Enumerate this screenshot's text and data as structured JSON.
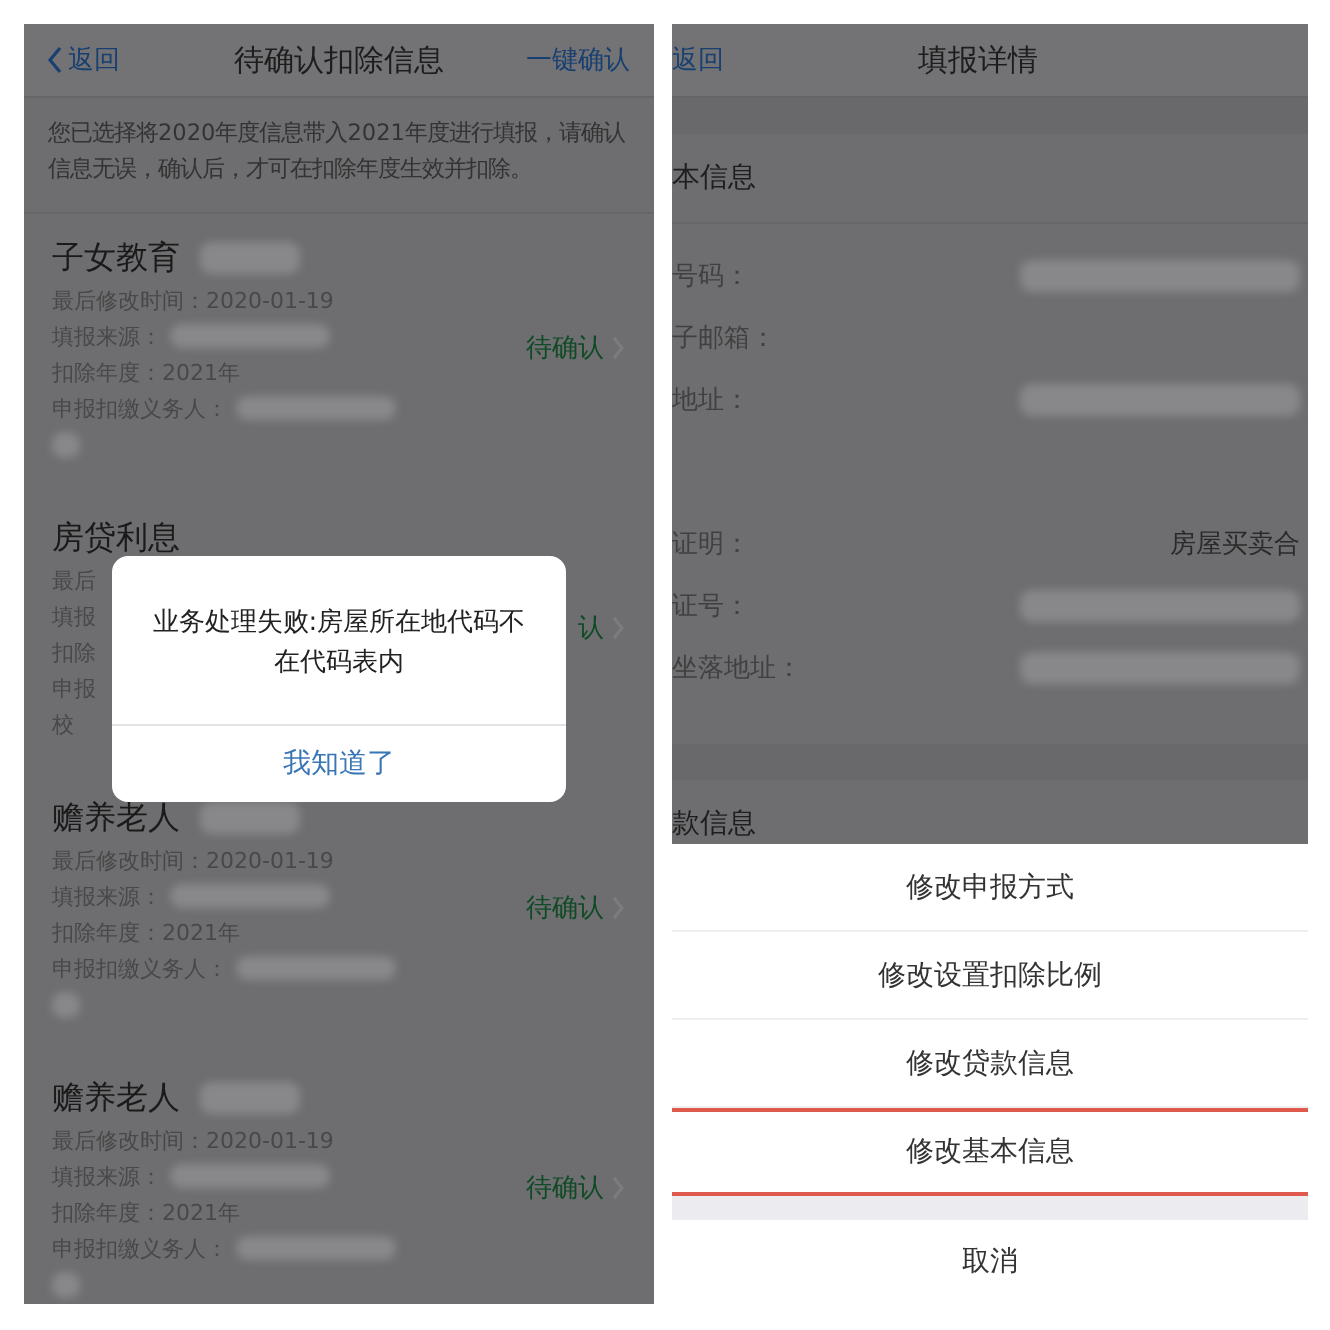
{
  "left_screen": {
    "nav": {
      "back": "返回",
      "title": "待确认扣除信息",
      "action": "一键确认"
    },
    "notice": "您已选择将2020年度信息带入2021年度进行填报，请确认信息无误，确认后，才可在扣除年度生效并扣除。",
    "cards": [
      {
        "title": "子女教育",
        "title_redacted": true,
        "rows": [
          {
            "label": "最后修改时间：",
            "value": "2020-01-19"
          },
          {
            "label": "填报来源：",
            "redacted": true
          },
          {
            "label": "扣除年度：",
            "value": "2021年"
          },
          {
            "label": "申报扣缴义务人：",
            "redacted": true
          }
        ],
        "extra_redacted": true,
        "status": "待确认"
      },
      {
        "title": "房贷利息",
        "rows": [
          {
            "label": "最后"
          },
          {
            "label": "填报"
          },
          {
            "label": "扣除"
          },
          {
            "label": "申报"
          }
        ],
        "extra": "校",
        "status": "认"
      },
      {
        "title": "赡养老人",
        "title_redacted": true,
        "rows": [
          {
            "label": "最后修改时间：",
            "value": "2020-01-19"
          },
          {
            "label": "填报来源：",
            "redacted": true
          },
          {
            "label": "扣除年度：",
            "value": "2021年"
          },
          {
            "label": "申报扣缴义务人：",
            "redacted": true
          }
        ],
        "extra_redacted": true,
        "status": "待确认"
      },
      {
        "title": "赡养老人",
        "title_redacted": true,
        "rows": [
          {
            "label": "最后修改时间：",
            "value": "2020-01-19"
          },
          {
            "label": "填报来源：",
            "redacted": true
          },
          {
            "label": "扣除年度：",
            "value": "2021年"
          },
          {
            "label": "申报扣缴义务人：",
            "redacted": true
          }
        ],
        "extra_redacted": true,
        "status": "待确认"
      }
    ],
    "dialog": {
      "message": "业务处理失败:房屋所在地代码不在代码表内",
      "button": "我知道了"
    }
  },
  "right_screen": {
    "nav": {
      "back": "返回",
      "title": "填报详情"
    },
    "sections": [
      {
        "title": "本信息",
        "rows": [
          {
            "label": "号码：",
            "redacted": true
          },
          {
            "label": "子邮箱："
          },
          {
            "label": "地址：",
            "redacted": true,
            "spacer_after": true
          },
          {
            "label": "证明：",
            "value": "房屋买卖合"
          },
          {
            "label": "证号：",
            "redacted": true
          },
          {
            "label": "坐落地址：",
            "redacted": true
          }
        ]
      },
      {
        "title": "款信息"
      }
    ],
    "action_sheet": {
      "items": [
        {
          "label": "修改申报方式",
          "highlighted": false
        },
        {
          "label": "修改设置扣除比例",
          "highlighted": false
        },
        {
          "label": "修改贷款信息",
          "highlighted": false
        },
        {
          "label": "修改基本信息",
          "highlighted": true
        }
      ],
      "cancel": "取消"
    }
  }
}
